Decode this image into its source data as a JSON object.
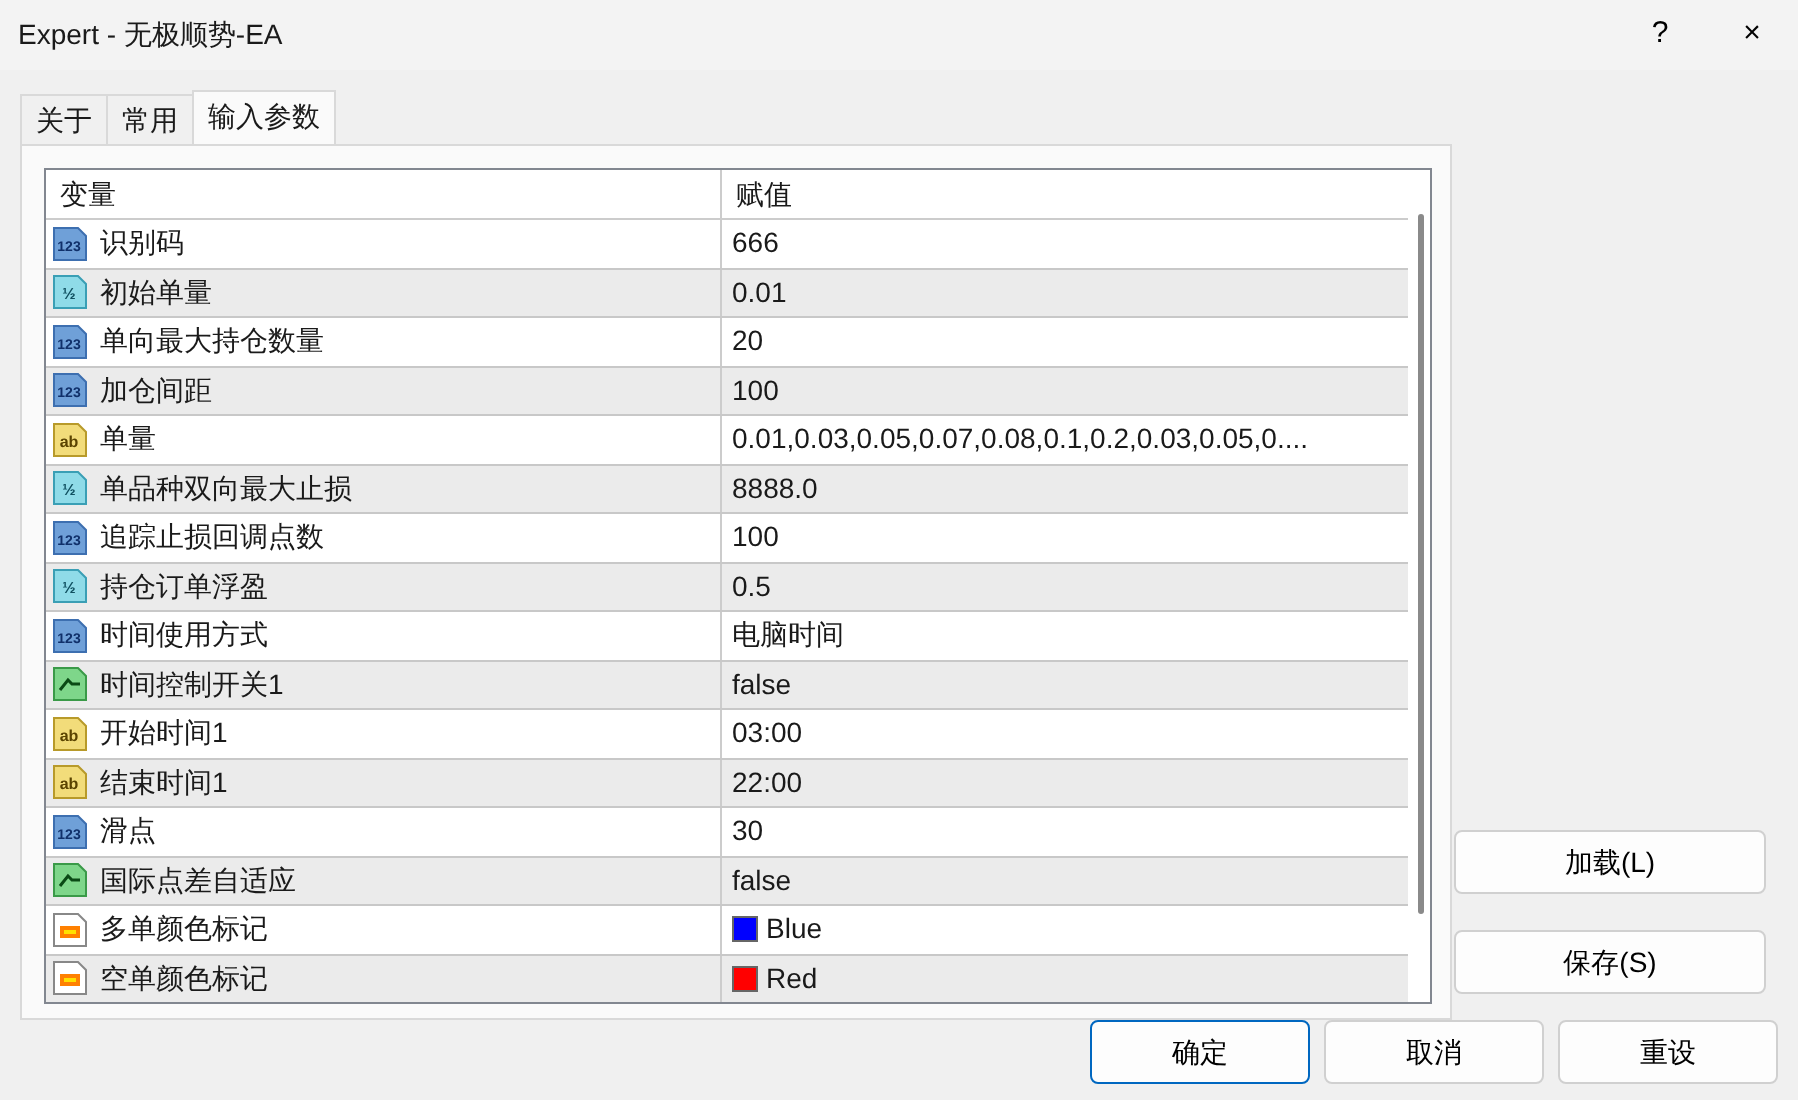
{
  "window": {
    "title": "Expert - 无极顺势-EA",
    "help": "?",
    "close": "×"
  },
  "tabs": [
    {
      "label": "关于",
      "selected": false
    },
    {
      "label": "常用",
      "selected": false
    },
    {
      "label": "输入参数",
      "selected": true
    }
  ],
  "table": {
    "columns": [
      "变量",
      "赋值"
    ],
    "rows": [
      {
        "kind": "int",
        "icon_label": "123",
        "name": "识别码",
        "value": "666"
      },
      {
        "kind": "double",
        "icon_label": "½",
        "name": "初始单量",
        "value": "0.01"
      },
      {
        "kind": "int",
        "icon_label": "123",
        "name": "单向最大持仓数量",
        "value": "20"
      },
      {
        "kind": "int",
        "icon_label": "123",
        "name": "加仓间距",
        "value": "100"
      },
      {
        "kind": "string",
        "icon_label": "ab",
        "name": "单量",
        "value": "0.01,0.03,0.05,0.07,0.08,0.1,0.2,0.03,0.05,0...."
      },
      {
        "kind": "double",
        "icon_label": "½",
        "name": "单品种双向最大止损",
        "value": "8888.0"
      },
      {
        "kind": "int",
        "icon_label": "123",
        "name": "追踪止损回调点数",
        "value": "100"
      },
      {
        "kind": "double",
        "icon_label": "½",
        "name": "持仓订单浮盈",
        "value": "0.5"
      },
      {
        "kind": "int",
        "icon_label": "123",
        "name": "时间使用方式",
        "value": "电脑时间"
      },
      {
        "kind": "bool",
        "name": "时间控制开关1",
        "value": "false"
      },
      {
        "kind": "string",
        "icon_label": "ab",
        "name": "开始时间1",
        "value": "03:00"
      },
      {
        "kind": "string",
        "icon_label": "ab",
        "name": "结束时间1",
        "value": "22:00"
      },
      {
        "kind": "int",
        "icon_label": "123",
        "name": "滑点",
        "value": "30"
      },
      {
        "kind": "bool",
        "name": "国际点差自适应",
        "value": "false"
      },
      {
        "kind": "color",
        "name": "多单颜色标记",
        "value": "Blue",
        "color": "#0000ff"
      },
      {
        "kind": "color",
        "name": "空单颜色标记",
        "value": "Red",
        "color": "#ff0000"
      }
    ]
  },
  "side_buttons": [
    "加载(L)",
    "保存(S)"
  ],
  "buttons": [
    {
      "label": "确定",
      "default": true
    },
    {
      "label": "取消",
      "default": false
    },
    {
      "label": "重设",
      "default": false
    }
  ]
}
